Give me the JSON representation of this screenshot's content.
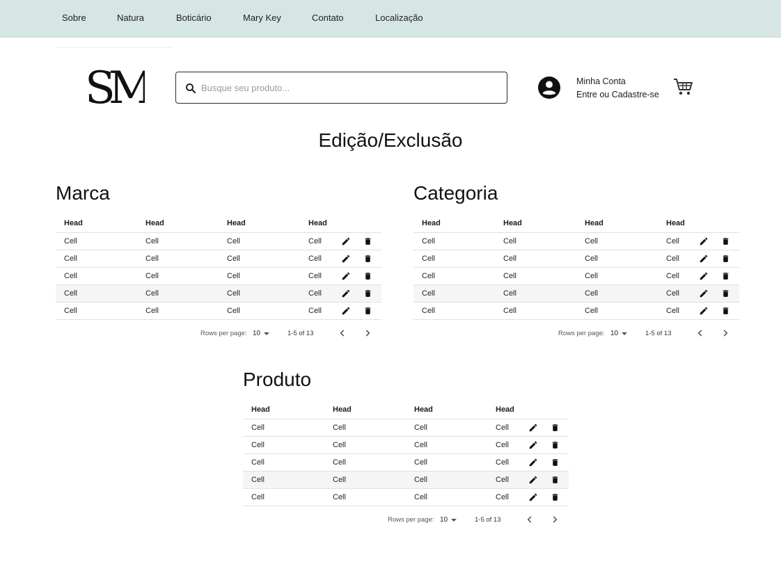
{
  "nav": {
    "items": [
      {
        "label": "Sobre"
      },
      {
        "label": "Natura"
      },
      {
        "label": "Boticário"
      },
      {
        "label": "Mary Key"
      },
      {
        "label": "Contato"
      },
      {
        "label": "Localização"
      }
    ]
  },
  "header": {
    "logo_text": "SM",
    "search_placeholder": "Busque seu produto...",
    "account_title": "Minha Conta",
    "account_subtitle": "Entre ou Cadastre-se",
    "icons": [
      "search-icon",
      "account-circle-icon",
      "shopping-cart-icon"
    ]
  },
  "page_title": "Edição/Exclusão",
  "tables": {
    "marca": {
      "title": "Marca",
      "headers": [
        "Head",
        "Head",
        "Head",
        "Head"
      ],
      "rows": [
        [
          "Cell",
          "Cell",
          "Cell",
          "Cell"
        ],
        [
          "Cell",
          "Cell",
          "Cell",
          "Cell"
        ],
        [
          "Cell",
          "Cell",
          "Cell",
          "Cell"
        ],
        [
          "Cell",
          "Cell",
          "Cell",
          "Cell"
        ],
        [
          "Cell",
          "Cell",
          "Cell",
          "Cell"
        ]
      ],
      "pagination": {
        "rows_label": "Rows per page:",
        "rows_value": "10",
        "range": "1-5 of 13"
      }
    },
    "categoria": {
      "title": "Categoria",
      "headers": [
        "Head",
        "Head",
        "Head",
        "Head"
      ],
      "rows": [
        [
          "Cell",
          "Cell",
          "Cell",
          "Cell"
        ],
        [
          "Cell",
          "Cell",
          "Cell",
          "Cell"
        ],
        [
          "Cell",
          "Cell",
          "Cell",
          "Cell"
        ],
        [
          "Cell",
          "Cell",
          "Cell",
          "Cell"
        ],
        [
          "Cell",
          "Cell",
          "Cell",
          "Cell"
        ]
      ],
      "pagination": {
        "rows_label": "Rows per page:",
        "rows_value": "10",
        "range": "1-5 of 13"
      }
    },
    "produto": {
      "title": "Produto",
      "headers": [
        "Head",
        "Head",
        "Head",
        "Head"
      ],
      "rows": [
        [
          "Cell",
          "Cell",
          "Cell",
          "Cell"
        ],
        [
          "Cell",
          "Cell",
          "Cell",
          "Cell"
        ],
        [
          "Cell",
          "Cell",
          "Cell",
          "Cell"
        ],
        [
          "Cell",
          "Cell",
          "Cell",
          "Cell"
        ],
        [
          "Cell",
          "Cell",
          "Cell",
          "Cell"
        ]
      ],
      "pagination": {
        "rows_label": "Rows per page:",
        "rows_value": "10",
        "range": "1-5 of 13"
      }
    }
  },
  "colors": {
    "nav_background": "#d5e6e5",
    "highlight_row": "#f5f5f5",
    "text": "#1c1c1c"
  }
}
